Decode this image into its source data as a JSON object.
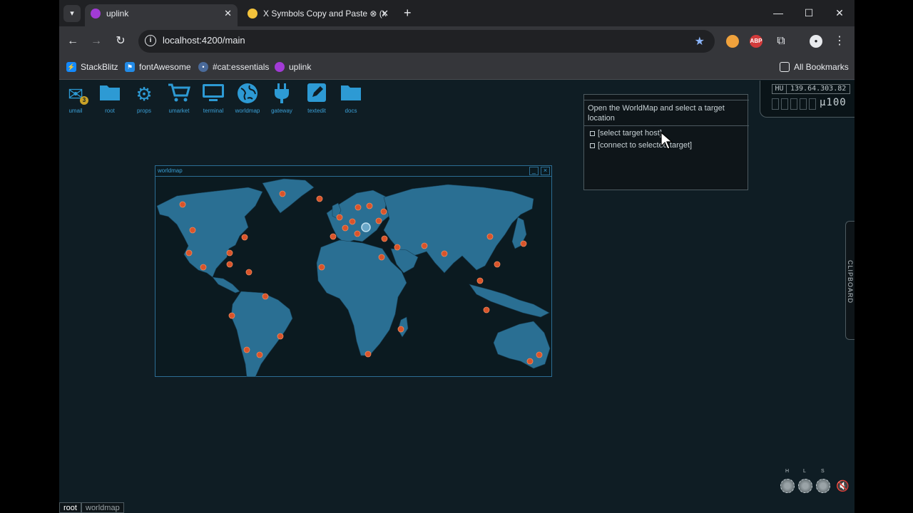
{
  "browser": {
    "tabs": [
      {
        "label": "uplink",
        "active": true
      },
      {
        "label": "X Symbols Copy and Paste ⊗ (x",
        "active": false
      }
    ],
    "url": "localhost:4200/main",
    "bookmarks": [
      {
        "label": "StackBlitz"
      },
      {
        "label": "fontAwesome"
      },
      {
        "label": "#cat:essentials"
      },
      {
        "label": "uplink"
      }
    ],
    "all_bookmarks": "All Bookmarks",
    "extensions": {
      "abp": "ABP"
    }
  },
  "desktop": {
    "icons": [
      {
        "label": "umail",
        "icon": "envelope-icon",
        "badge": "3"
      },
      {
        "label": "root",
        "icon": "folder-icon"
      },
      {
        "label": "props",
        "icon": "gear-icon"
      },
      {
        "label": "umarket",
        "icon": "cart-icon"
      },
      {
        "label": "terminal",
        "icon": "monitor-icon"
      },
      {
        "label": "worldmap",
        "icon": "globe-icon"
      },
      {
        "label": "gateway",
        "icon": "plug-icon"
      },
      {
        "label": "textedit",
        "icon": "pencil-icon"
      },
      {
        "label": "docs",
        "icon": "folder-icon"
      }
    ],
    "accent": "#2d9ad4"
  },
  "worldmap_window": {
    "title": "worldmap",
    "minimize": "_",
    "close": "×",
    "node_color": "#d9542b",
    "land_color": "#2a6f93"
  },
  "mission": {
    "heading": "Open the WorldMap and select a target location",
    "tasks": [
      {
        "label": "[select target host]",
        "done": false
      },
      {
        "label": "[connect to selected target]",
        "done": false
      }
    ]
  },
  "hud": {
    "country": "HU",
    "ip": "139.64.303.82",
    "credits": "µ100"
  },
  "clipboard": {
    "label": "CLIPBOARD"
  },
  "knobs": {
    "h": "H",
    "l": "L",
    "s": "S"
  },
  "taskbar": {
    "items": [
      "root",
      "worldmap"
    ]
  }
}
